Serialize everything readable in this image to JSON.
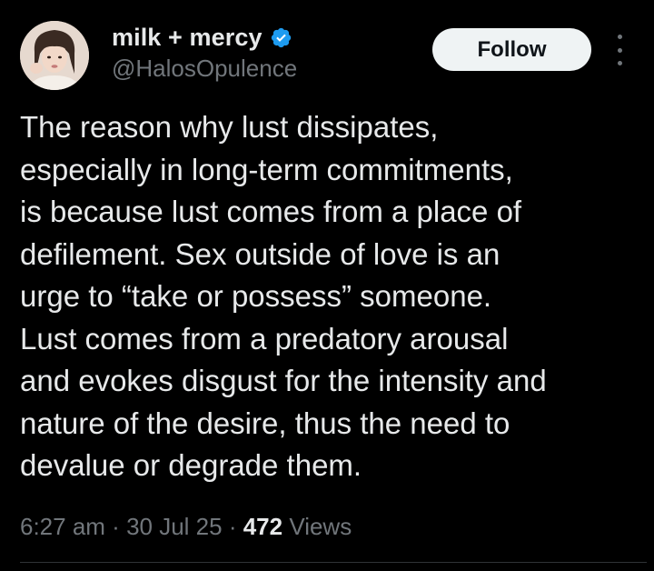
{
  "author": {
    "display_name": "milk + mercy",
    "handle": "@HalosOpulence",
    "verified": true,
    "avatar_icon": "profile-photo"
  },
  "follow_button": {
    "label": "Follow"
  },
  "more_menu": {
    "icon": "more-vertical-icon"
  },
  "tweet": {
    "lines": [
      "The reason why lust dissipates,",
      "especially in long-term commitments,",
      "is because lust comes from a place of",
      "defilement. Sex outside of love is an",
      "urge to “take or possess” someone.",
      "Lust comes from a predatory arousal",
      "and evokes disgust for the intensity and",
      "nature of the desire, thus the need to",
      "devalue or degrade them."
    ]
  },
  "meta": {
    "time": "6:27 am",
    "separator": " · ",
    "date": "30 Jul 25",
    "views_count": "472",
    "views_label": " Views"
  },
  "colors": {
    "background": "#000000",
    "text_primary": "#e7e9ea",
    "text_secondary": "#71767b",
    "verified_badge": "#1d9bf0",
    "follow_bg": "#eff3f4"
  }
}
